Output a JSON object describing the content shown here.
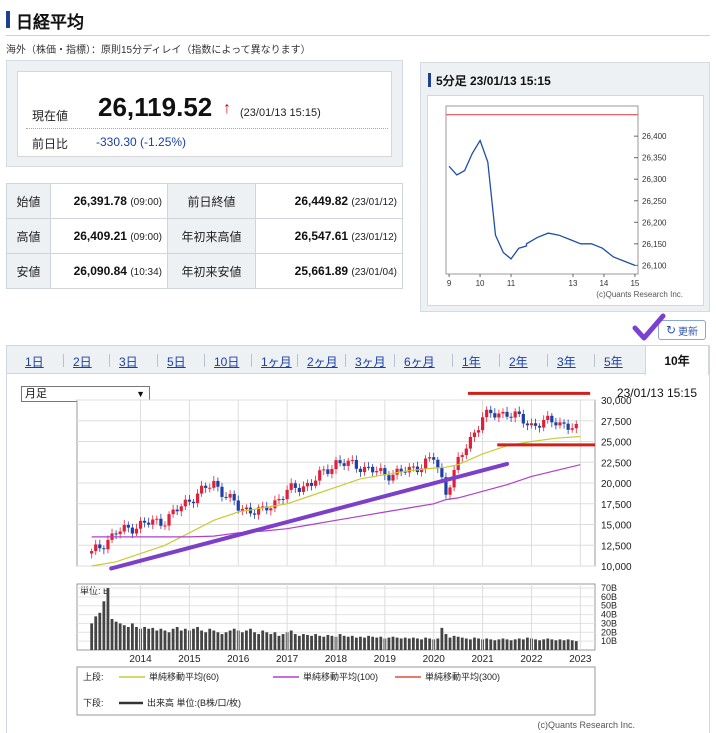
{
  "page": {
    "title": "日経平均",
    "notice": "海外（株価・指標）：原則15分ディレイ（指数によって異なります）"
  },
  "quote": {
    "current_label": "現在値",
    "current_value": "26,119.52",
    "arrow": "↑",
    "current_time": "(23/01/13 15:15)",
    "change_label": "前日比",
    "change_value": "-330.30 (-1.25%)"
  },
  "ohlc": {
    "rows": [
      {
        "label1": "始値",
        "value1": "26,391.78",
        "time1": "(09:00)",
        "label2": "前日終値",
        "value2": "26,449.82",
        "time2": "(23/01/12)"
      },
      {
        "label1": "高値",
        "value1": "26,409.21",
        "time1": "(09:00)",
        "label2": "年初来高値",
        "value2": "26,547.61",
        "time2": "(23/01/12)"
      },
      {
        "label1": "安値",
        "value1": "26,090.84",
        "time1": "(10:34)",
        "label2": "年初来安値",
        "value2": "25,661.89",
        "time2": "(23/01/04)"
      }
    ]
  },
  "intraday": {
    "title": "5分足 23/01/13 15:15",
    "credit": "(c)Quants Research Inc."
  },
  "refresh": {
    "label": "更新",
    "icon": "refresh-icon"
  },
  "tabs": {
    "items": [
      "1日",
      "2日",
      "3日",
      "5日",
      "10日",
      "1ヶ月",
      "2ヶ月",
      "3ヶ月",
      "6ヶ月",
      "1年",
      "2年",
      "3年",
      "5年",
      "10年"
    ],
    "active": "10年"
  },
  "main_chart": {
    "period_select": "月足",
    "time": "23/01/13 15:15",
    "volume_unit": "単位: B",
    "credit": "(c)Quants Research Inc.",
    "legend_upper_label": "上段:",
    "legend_lower_label": "下段:",
    "legend_items": [
      "単純移動平均(60)",
      "単純移動平均(100)",
      "単純移動平均(300)"
    ],
    "legend_volume": "出来高 単位:(B株/口/枚)"
  },
  "chart_data": [
    {
      "type": "line",
      "chart": "intraday-5min",
      "x": [
        9,
        9.25,
        9.5,
        9.75,
        10,
        10.25,
        10.5,
        10.75,
        11,
        11.25,
        11.5,
        12.5,
        12.75,
        13,
        13.25,
        13.5,
        13.75,
        14,
        14.25,
        14.5,
        14.75,
        15
      ],
      "values": [
        26330,
        26310,
        26320,
        26360,
        26390,
        26340,
        26170,
        26130,
        26115,
        26140,
        26145,
        26150,
        26165,
        26175,
        26170,
        26160,
        26150,
        26150,
        26140,
        26120,
        26110,
        26100
      ],
      "xticks": [
        "9",
        "10",
        "11",
        "13",
        "14",
        "15"
      ],
      "yticks": [
        "26,400",
        "26,350",
        "26,300",
        "26,250",
        "26,200",
        "26,150",
        "26,100"
      ],
      "ylim": [
        26080,
        26470
      ],
      "reference_line": 26449.82,
      "colors": {
        "line": "#1f4fa6",
        "reference": "#e05050"
      }
    },
    {
      "type": "candlestick",
      "chart": "monthly-10y",
      "x": [
        2013.0,
        2013.5,
        2014.0,
        2014.5,
        2015.0,
        2015.5,
        2016.0,
        2016.5,
        2017.0,
        2017.5,
        2018.0,
        2018.5,
        2019.0,
        2019.5,
        2020.0,
        2020.25,
        2020.5,
        2021.0,
        2021.5,
        2022.0,
        2022.5,
        2023.0
      ],
      "values": [
        11500,
        14000,
        15000,
        15500,
        18000,
        20000,
        17000,
        16500,
        19000,
        20000,
        22500,
        22000,
        21000,
        21500,
        23000,
        19000,
        22500,
        28000,
        28500,
        27000,
        27500,
        26119
      ],
      "ma60": [
        10000,
        10500,
        11500,
        12500,
        14000,
        15500,
        16500,
        17000,
        17500,
        18500,
        19500,
        20500,
        21000,
        21500,
        21800,
        21900,
        22200,
        23500,
        24500,
        25000,
        25400,
        25600
      ],
      "ma100": [
        13500,
        13500,
        13500,
        13500,
        13500,
        13600,
        14000,
        14200,
        14500,
        15000,
        15500,
        16000,
        16500,
        17000,
        17500,
        18000,
        18200,
        19000,
        19800,
        20800,
        21500,
        22200
      ],
      "xticks": [
        "2014",
        "2015",
        "2016",
        "2017",
        "2018",
        "2019",
        "2020",
        "2021",
        "2022",
        "2023"
      ],
      "yticks": [
        "30,000",
        "27,500",
        "25,000",
        "22,500",
        "20,000",
        "17,500",
        "15,000",
        "12,500",
        "10,000"
      ],
      "ylim": [
        10000,
        30000
      ],
      "colors": {
        "up": "#e0203a",
        "down": "#1f3fa6",
        "ma60": "#c7cc33",
        "ma100": "#b040c8",
        "ma300": "#e0503a"
      }
    },
    {
      "type": "bar",
      "chart": "monthly-volume",
      "yticks": [
        "70B",
        "60B",
        "50B",
        "40B",
        "30B",
        "20B",
        "10B"
      ],
      "ylim": [
        0,
        70
      ],
      "values": [
        30,
        38,
        42,
        55,
        70,
        35,
        32,
        30,
        28,
        26,
        30,
        26,
        24,
        26,
        24,
        25,
        22,
        24,
        22,
        20,
        24,
        26,
        22,
        24,
        22,
        24,
        26,
        22,
        20,
        24,
        22,
        20,
        18,
        20,
        22,
        24,
        22,
        20,
        22,
        24,
        20,
        18,
        22,
        20,
        18,
        20,
        16,
        18,
        20,
        22,
        18,
        16,
        18,
        17,
        16,
        18,
        16,
        15,
        17,
        16,
        15,
        18,
        16,
        15,
        16,
        14,
        15,
        14,
        16,
        15,
        14,
        15,
        13,
        14,
        15,
        14,
        13,
        14,
        13,
        14,
        13,
        12,
        14,
        13,
        12,
        13,
        25,
        18,
        14,
        16,
        15,
        14,
        13,
        12,
        14,
        13,
        12,
        13,
        12,
        11,
        12,
        13,
        12,
        11,
        12,
        13,
        12,
        14,
        13,
        12,
        11,
        12,
        13,
        12,
        11,
        12,
        11,
        12,
        11,
        10
      ],
      "colors": {
        "bar": "#444444"
      }
    }
  ]
}
